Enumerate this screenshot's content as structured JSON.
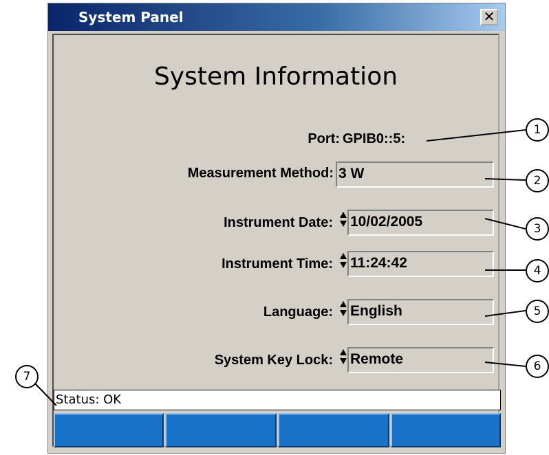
{
  "window": {
    "title": "System Panel",
    "close_glyph": "✕"
  },
  "heading": "System Information",
  "fields": {
    "port_label": "Port:",
    "port_value": "GPIB0::5:",
    "method_label": "Measurement Method:",
    "method_value": "3 W",
    "date_label": "Instrument Date:",
    "date_value": "10/02/2005",
    "time_label": "Instrument Time:",
    "time_value": "11:24:42",
    "language_label": "Language:",
    "language_value": "English",
    "keylock_label": "System Key Lock:",
    "keylock_value": "Remote"
  },
  "status": "Status: OK",
  "softkeys": [
    "",
    "",
    "",
    ""
  ],
  "callouts": [
    "1",
    "2",
    "3",
    "4",
    "5",
    "6",
    "7"
  ],
  "colors": {
    "softkey": "#1873c8",
    "panel": "#d4d0c8",
    "titlebar": "#0a246a"
  }
}
